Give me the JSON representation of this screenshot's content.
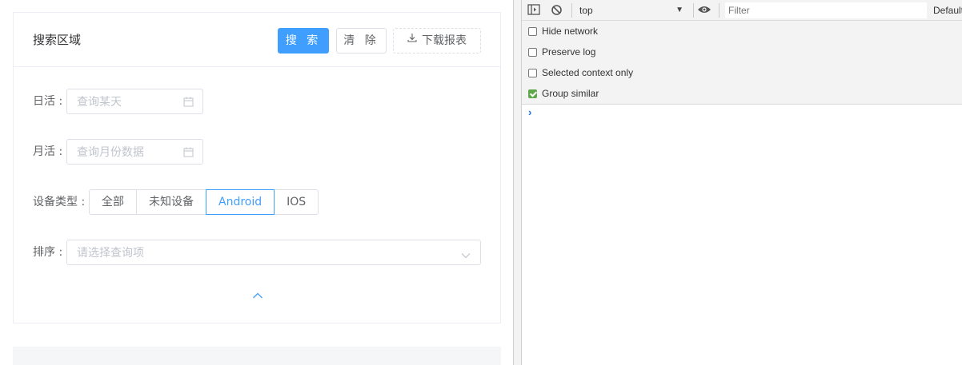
{
  "search_card": {
    "title": "搜索区域",
    "buttons": {
      "search": "搜 索",
      "clear": "清 除",
      "download": "下载报表"
    },
    "fields": {
      "daily_active": {
        "label": "日活 :",
        "placeholder": "查询某天"
      },
      "monthly_active": {
        "label": "月活 :",
        "placeholder": "查询月份数据"
      },
      "device_type": {
        "label": "设备类型 :",
        "options": [
          "全部",
          "未知设备",
          "Android",
          "IOS"
        ],
        "selected": "Android"
      },
      "sort": {
        "label": "排序 :",
        "placeholder": "请选择查询项"
      }
    }
  },
  "console": {
    "context": "top",
    "filter_placeholder": "Filter",
    "levels": "Default levels",
    "settings": [
      {
        "label": "Hide network",
        "checked": false
      },
      {
        "label": "Preserve log",
        "checked": false
      },
      {
        "label": "Selected context only",
        "checked": false
      },
      {
        "label": "Group similar",
        "checked": true
      }
    ],
    "prompt": "›"
  },
  "colors": {
    "primary": "#409eff",
    "border": "#dcdfe6",
    "placeholder": "#c0c4cc",
    "checkbox_checked": "#5ea84a"
  }
}
